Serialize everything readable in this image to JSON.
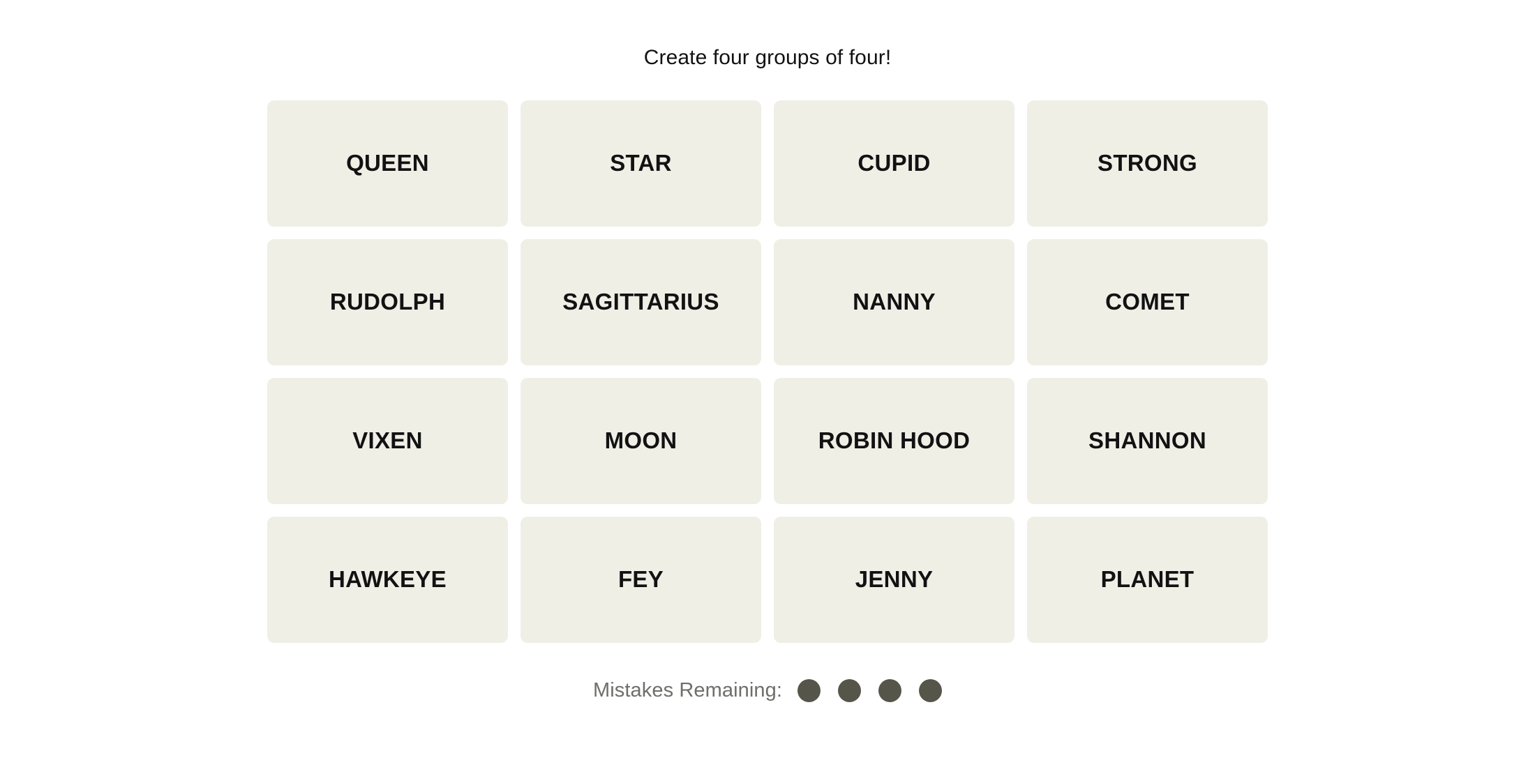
{
  "game": {
    "instruction": "Create four groups of four!",
    "tiles": [
      {
        "label": "QUEEN"
      },
      {
        "label": "STAR"
      },
      {
        "label": "CUPID"
      },
      {
        "label": "STRONG"
      },
      {
        "label": "RUDOLPH"
      },
      {
        "label": "SAGITTARIUS"
      },
      {
        "label": "NANNY"
      },
      {
        "label": "COMET"
      },
      {
        "label": "VIXEN"
      },
      {
        "label": "MOON"
      },
      {
        "label": "ROBIN HOOD"
      },
      {
        "label": "SHANNON"
      },
      {
        "label": "HAWKEYE"
      },
      {
        "label": "FEY"
      },
      {
        "label": "JENNY"
      },
      {
        "label": "PLANET"
      }
    ],
    "mistakes": {
      "label": "Mistakes Remaining:",
      "remaining": 4,
      "dots": [
        {
          "state": "filled"
        },
        {
          "state": "filled"
        },
        {
          "state": "filled"
        },
        {
          "state": "filled"
        }
      ]
    },
    "colors": {
      "page_background": "#ffffff",
      "tile_background": "#efefe6",
      "tile_text": "#121213",
      "instruction_text": "#121213",
      "mistakes_label_text": "#6e6e6a",
      "mistake_dot": "#565549"
    }
  }
}
